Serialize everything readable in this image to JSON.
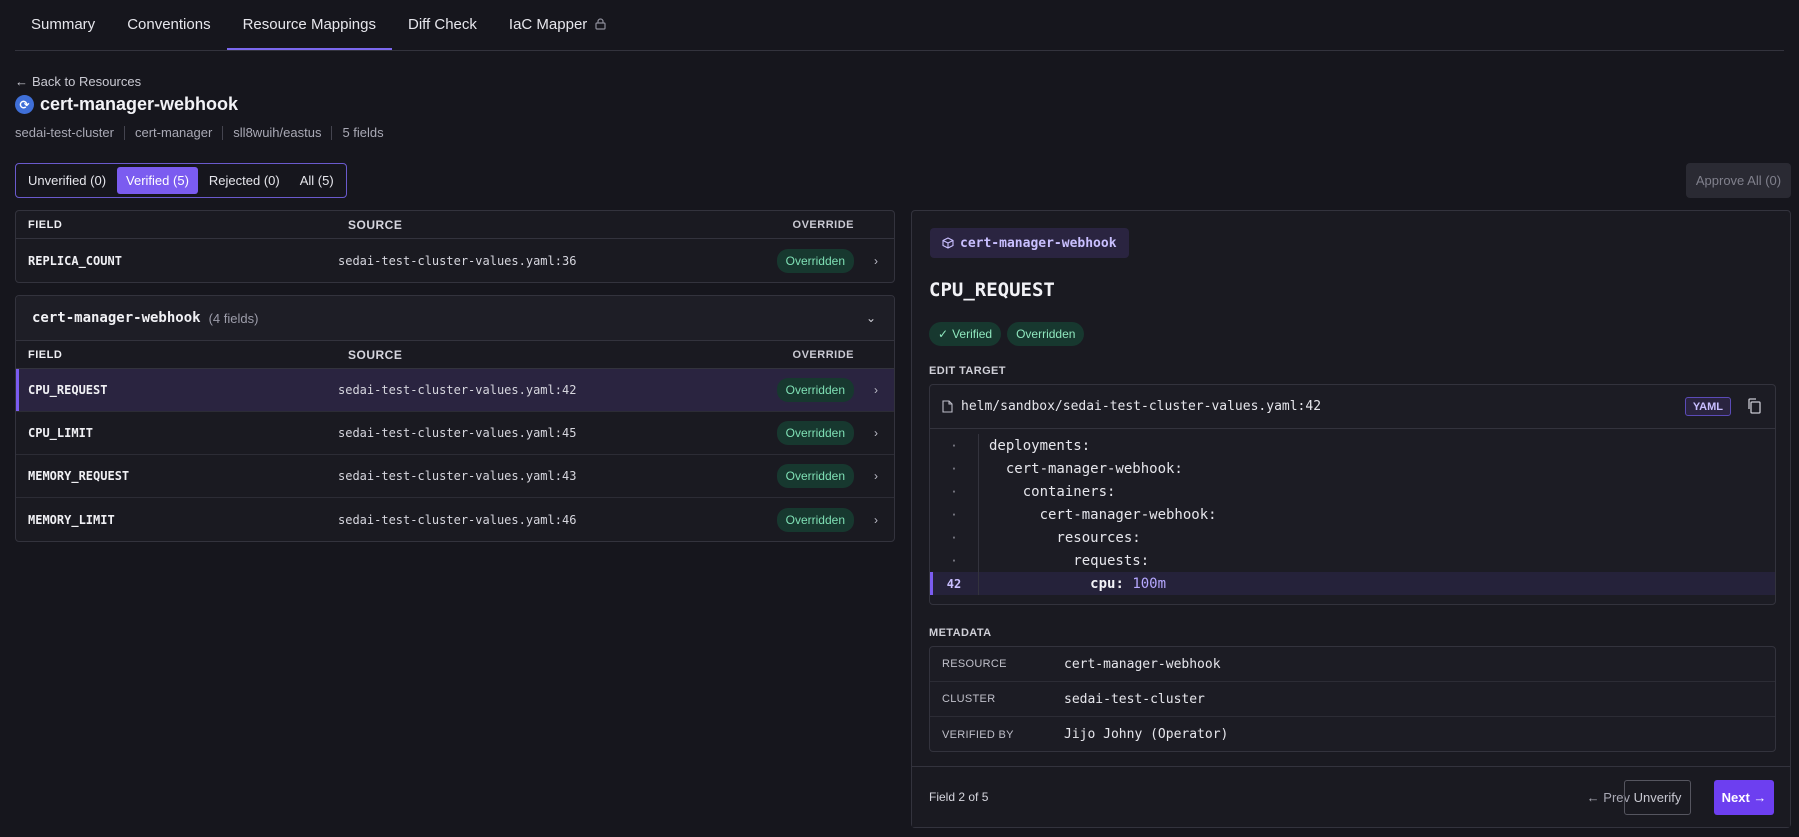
{
  "tabs": [
    {
      "label": "Summary"
    },
    {
      "label": "Conventions"
    },
    {
      "label": "Resource Mappings"
    },
    {
      "label": "Diff Check"
    },
    {
      "label": "IaC Mapper"
    }
  ],
  "back_label": "Back to Resources",
  "resource": {
    "name": "cert-manager-webhook",
    "cluster": "sedai-test-cluster",
    "namespace": "cert-manager",
    "region": "sll8wuih/eastus",
    "fields_count": "5 fields"
  },
  "filters": [
    {
      "label": "Unverified (0)"
    },
    {
      "label": "Verified (5)"
    },
    {
      "label": "Rejected (0)"
    },
    {
      "label": "All (5)"
    }
  ],
  "approve_all_label": "Approve All (0)",
  "table_headers": {
    "field": "FIELD",
    "source": "SOURCE",
    "override": "OVERRIDE"
  },
  "top_rows": [
    {
      "field": "REPLICA_COUNT",
      "source": "sedai-test-cluster-values.yaml:36",
      "override": "Overridden"
    }
  ],
  "group": {
    "name": "cert-manager-webhook",
    "count": "(4 fields)",
    "rows": [
      {
        "field": "CPU_REQUEST",
        "source": "sedai-test-cluster-values.yaml:42",
        "override": "Overridden"
      },
      {
        "field": "CPU_LIMIT",
        "source": "sedai-test-cluster-values.yaml:45",
        "override": "Overridden"
      },
      {
        "field": "MEMORY_REQUEST",
        "source": "sedai-test-cluster-values.yaml:43",
        "override": "Overridden"
      },
      {
        "field": "MEMORY_LIMIT",
        "source": "sedai-test-cluster-values.yaml:46",
        "override": "Overridden"
      }
    ]
  },
  "detail": {
    "chip": "cert-manager-webhook",
    "field_title": "CPU_REQUEST",
    "status_verified": "Verified",
    "status_overridden": "Overridden",
    "edit_target_label": "EDIT TARGET",
    "file_path": "helm/sandbox/sedai-test-cluster-values.yaml:42",
    "yaml_tag": "YAML",
    "code_lines": [
      {
        "ln": "·",
        "text": "deployments:"
      },
      {
        "ln": "·",
        "text": "  cert-manager-webhook:"
      },
      {
        "ln": "·",
        "text": "    containers:"
      },
      {
        "ln": "·",
        "text": "      cert-manager-webhook:"
      },
      {
        "ln": "·",
        "text": "        resources:"
      },
      {
        "ln": "·",
        "text": "          requests:"
      }
    ],
    "highlight_line": {
      "ln": "42",
      "indent": "            ",
      "key": "cpu:",
      "value": "100m"
    },
    "metadata_label": "METADATA",
    "metadata": [
      {
        "key": "RESOURCE",
        "value": "cert-manager-webhook"
      },
      {
        "key": "CLUSTER",
        "value": "sedai-test-cluster"
      },
      {
        "key": "VERIFIED BY",
        "value": "Jijo Johny (Operator)"
      }
    ],
    "footer_text": "Field 2 of 5",
    "prev_label": "← Prev",
    "unverify_label": "Unverify",
    "next_label": "Next →"
  }
}
